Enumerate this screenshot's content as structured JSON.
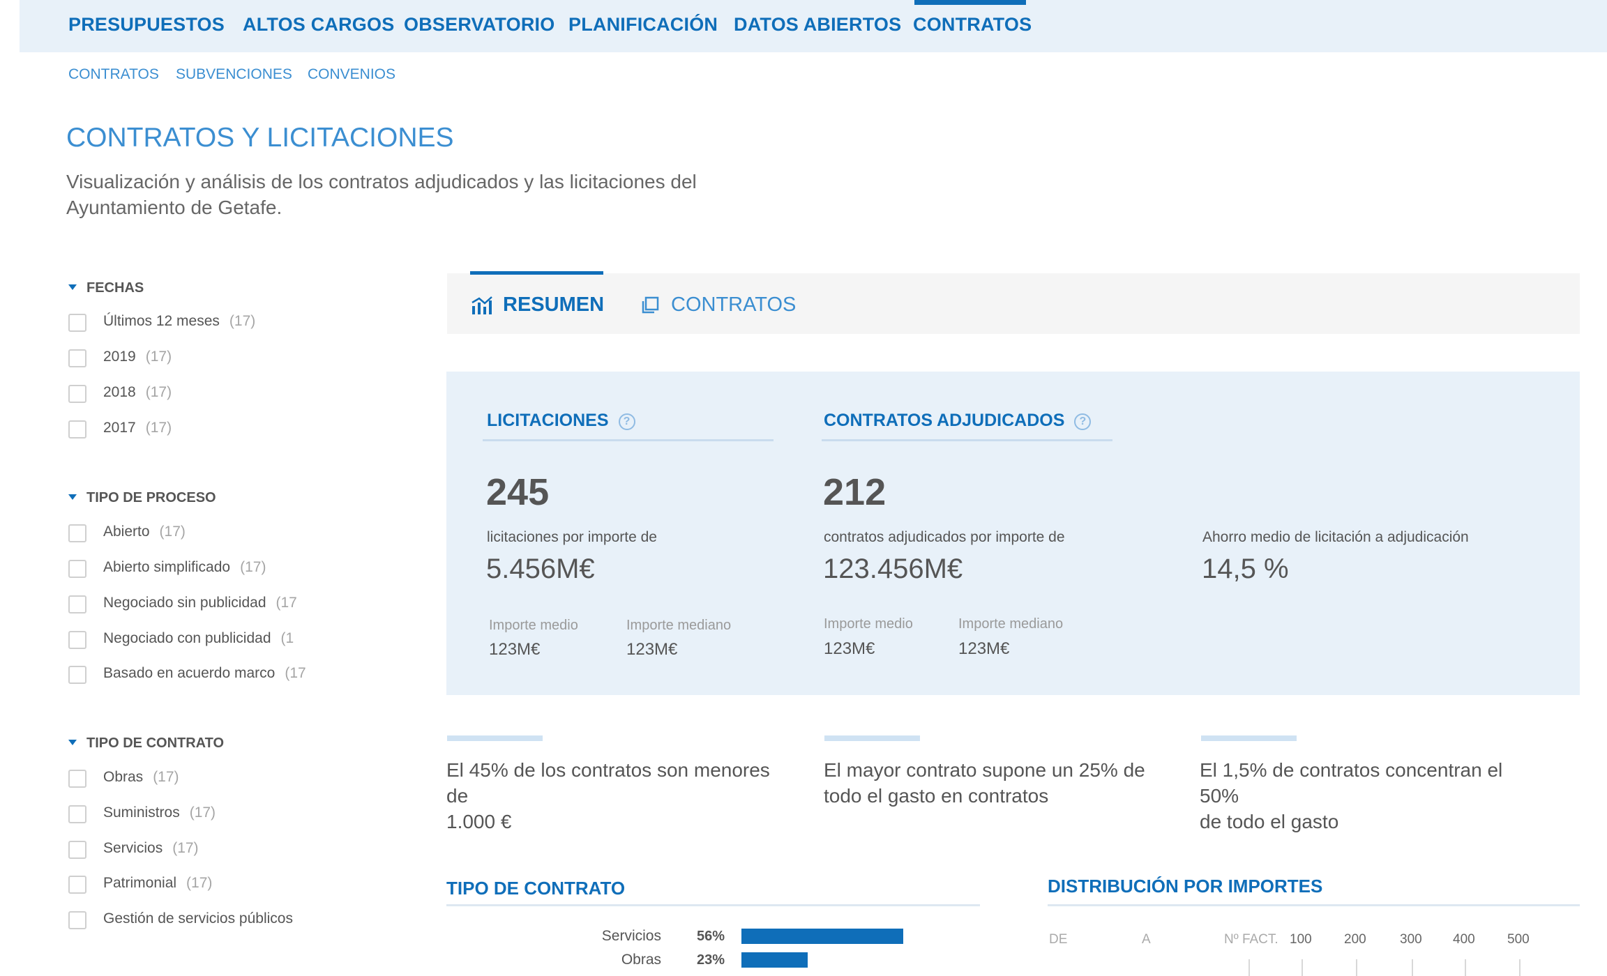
{
  "topnav": {
    "items": [
      "PRESUPUESTOS",
      "ALTOS CARGOS",
      "OBSERVATORIO",
      "PLANIFICACIÓN",
      "DATOS ABIERTOS",
      "CONTRATOS"
    ],
    "active": "CONTRATOS"
  },
  "subnav": {
    "items": [
      "CONTRATOS",
      "SUBVENCIONES",
      "CONVENIOS"
    ]
  },
  "page": {
    "title": "CONTRATOS Y LICITACIONES",
    "description_line1": "Visualización y análisis de los contratos adjudicados y las licitaciones del",
    "description_line2": "Ayuntamiento de Getafe."
  },
  "filters": [
    {
      "title": "FECHAS",
      "options": [
        {
          "label": "Últimos 12 meses",
          "count": "(17)"
        },
        {
          "label": "2019",
          "count": "(17)"
        },
        {
          "label": "2018",
          "count": "(17)"
        },
        {
          "label": "2017",
          "count": "(17)"
        }
      ]
    },
    {
      "title": "TIPO DE PROCESO",
      "options": [
        {
          "label": "Abierto",
          "count": "(17)"
        },
        {
          "label": "Abierto simplificado",
          "count": "(17)"
        },
        {
          "label": "Negociado sin publicidad",
          "count": "(17"
        },
        {
          "label": "Negociado con publicidad",
          "count": "(1"
        },
        {
          "label": "Basado en acuerdo marco",
          "count": "(17"
        }
      ]
    },
    {
      "title": "TIPO DE CONTRATO",
      "options": [
        {
          "label": "Obras",
          "count": "(17)"
        },
        {
          "label": "Suministros",
          "count": "(17)"
        },
        {
          "label": "Servicios",
          "count": "(17)"
        },
        {
          "label": "Patrimonial",
          "count": "(17)"
        },
        {
          "label": "Gestión de servicios públicos",
          "count": ""
        }
      ]
    }
  ],
  "tabs": {
    "resumen": "RESUMEN",
    "contratos": "CONTRATOS",
    "active": "resumen"
  },
  "summary": {
    "licitaciones": {
      "heading": "LICITACIONES",
      "count": "245",
      "caption": "licitaciones por importe de",
      "amount": "5.456M€",
      "mean_label": "Importe medio",
      "mean_value": "123M€",
      "median_label": "Importe mediano",
      "median_value": "123M€"
    },
    "adjudicados": {
      "heading": "CONTRATOS ADJUDICADOS",
      "count": "212",
      "caption": "contratos adjudicados por importe de",
      "amount": "123.456M€",
      "mean_label": "Importe medio",
      "mean_value": "123M€",
      "median_label": "Importe mediano",
      "median_value": "123M€"
    },
    "ahorro": {
      "caption": "Ahorro medio de licitación a adjudicación",
      "value": "14,5 %"
    }
  },
  "highlights": [
    {
      "line1": "El 45% de los contratos son menores de",
      "line2": "1.000 €"
    },
    {
      "line1": "El mayor contrato supone un 25% de",
      "line2": "todo el gasto en contratos"
    },
    {
      "line1": "El 1,5% de contratos concentran el 50%",
      "line2": "de todo el gasto"
    }
  ],
  "tipo_contrato": {
    "title": "TIPO DE CONTRATO",
    "bars": [
      {
        "category": "Servicios",
        "percent": 56,
        "label": "56%"
      },
      {
        "category": "Obras",
        "percent": 23,
        "label": "23%"
      }
    ]
  },
  "distribucion": {
    "title": "DISTRIBUCIÓN POR IMPORTES",
    "col_de": "DE",
    "col_a": "A",
    "col_nfact": "Nº FACT.",
    "ticks": [
      "100",
      "200",
      "300",
      "400",
      "500"
    ]
  },
  "colors": {
    "accent": "#0f6eb9",
    "panel": "#e8f1f9",
    "light_accent": "#3b8ed1"
  },
  "icons": {
    "resumen_tab": "bar-chart-icon",
    "contratos_tab": "copy-documents-icon",
    "help": "question-circle-icon",
    "group_toggle": "caret-down-icon"
  }
}
